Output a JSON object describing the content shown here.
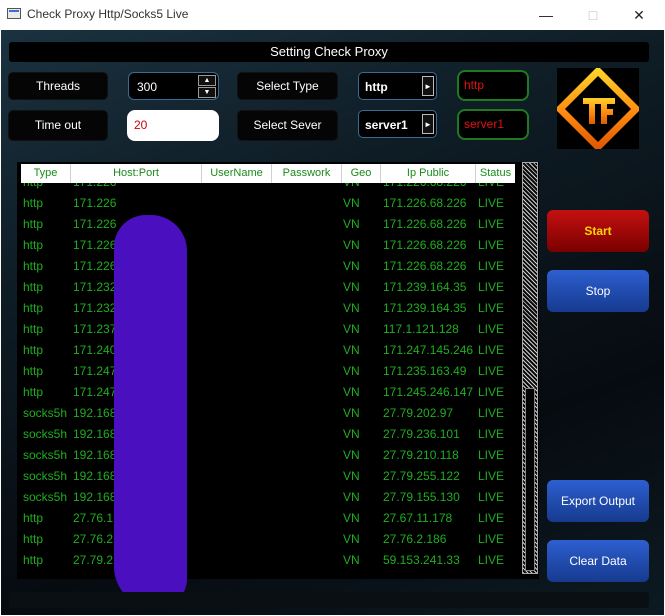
{
  "window": {
    "title": "Check Proxy Http/Socks5 Live"
  },
  "banner": "Setting Check Proxy",
  "controls": {
    "threads_label": "Threads",
    "threads_value": "300",
    "timeout_label": "Time out",
    "timeout_value": "20",
    "select_type_label": "Select Type",
    "type_value": "http",
    "type_echo": "http",
    "select_server_label": "Select Sever",
    "server_value": "server1",
    "server_echo": "server1"
  },
  "table": {
    "columns": [
      "Type",
      "Host:Port",
      "UserName",
      "Passwork",
      "Geo",
      "Ip Public",
      "Status"
    ],
    "rows": [
      {
        "type": "http",
        "host": "171.226",
        "geo": "VN",
        "ip": "171.226.68.226",
        "status": "LIVE"
      },
      {
        "type": "http",
        "host": "171.226",
        "geo": "VN",
        "ip": "171.226.68.226",
        "status": "LIVE"
      },
      {
        "type": "http",
        "host": "171.226",
        "geo": "VN",
        "ip": "171.226.68.226",
        "status": "LIVE"
      },
      {
        "type": "http",
        "host": "171.226.",
        "geo": "VN",
        "ip": "171.226.68.226",
        "status": "LIVE"
      },
      {
        "type": "http",
        "host": "171.226.6",
        "geo": "VN",
        "ip": "171.226.68.226",
        "status": "LIVE"
      },
      {
        "type": "http",
        "host": "171.232.7",
        "geo": "VN",
        "ip": "171.239.164.35",
        "status": "LIVE"
      },
      {
        "type": "http",
        "host": "171.232.7",
        "geo": "VN",
        "ip": "171.239.164.35",
        "status": "LIVE"
      },
      {
        "type": "http",
        "host": "171.237.1",
        "geo": "VN",
        "ip": "117.1.121.128",
        "status": "LIVE"
      },
      {
        "type": "http",
        "host": "171.240.",
        "geo": "VN",
        "ip": "171.247.145.246",
        "status": "LIVE"
      },
      {
        "type": "http",
        "host": "171.247.",
        "geo": "VN",
        "ip": "171.235.163.49",
        "status": "LIVE"
      },
      {
        "type": "http",
        "host": "171.247",
        "geo": "VN",
        "ip": "171.245.246.147",
        "status": "LIVE"
      },
      {
        "type": "socks5h",
        "host": "192.168",
        "geo": "VN",
        "ip": "27.79.202.97",
        "status": "LIVE"
      },
      {
        "type": "socks5h",
        "host": "192.168",
        "geo": "VN",
        "ip": "27.79.236.101",
        "status": "LIVE"
      },
      {
        "type": "socks5h",
        "host": "192.168",
        "geo": "VN",
        "ip": "27.79.210.118",
        "status": "LIVE"
      },
      {
        "type": "socks5h",
        "host": "192.168",
        "geo": "VN",
        "ip": "27.79.255.122",
        "status": "LIVE"
      },
      {
        "type": "socks5h",
        "host": "192.168",
        "geo": "VN",
        "ip": "27.79.155.130",
        "status": "LIVE"
      },
      {
        "type": "http",
        "host": "27.76.1",
        "geo": "VN",
        "ip": "27.67.11.178",
        "status": "LIVE"
      },
      {
        "type": "http",
        "host": "27.76.2",
        "geo": "VN",
        "ip": "27.76.2.186",
        "status": "LIVE"
      },
      {
        "type": "http",
        "host": "27.79.2",
        "geo": "VN",
        "ip": "59.153.241.33",
        "status": "LIVE"
      }
    ]
  },
  "buttons": {
    "start": "Start",
    "stop": "Stop",
    "export": "Export Output",
    "clear": "Clear Data"
  }
}
